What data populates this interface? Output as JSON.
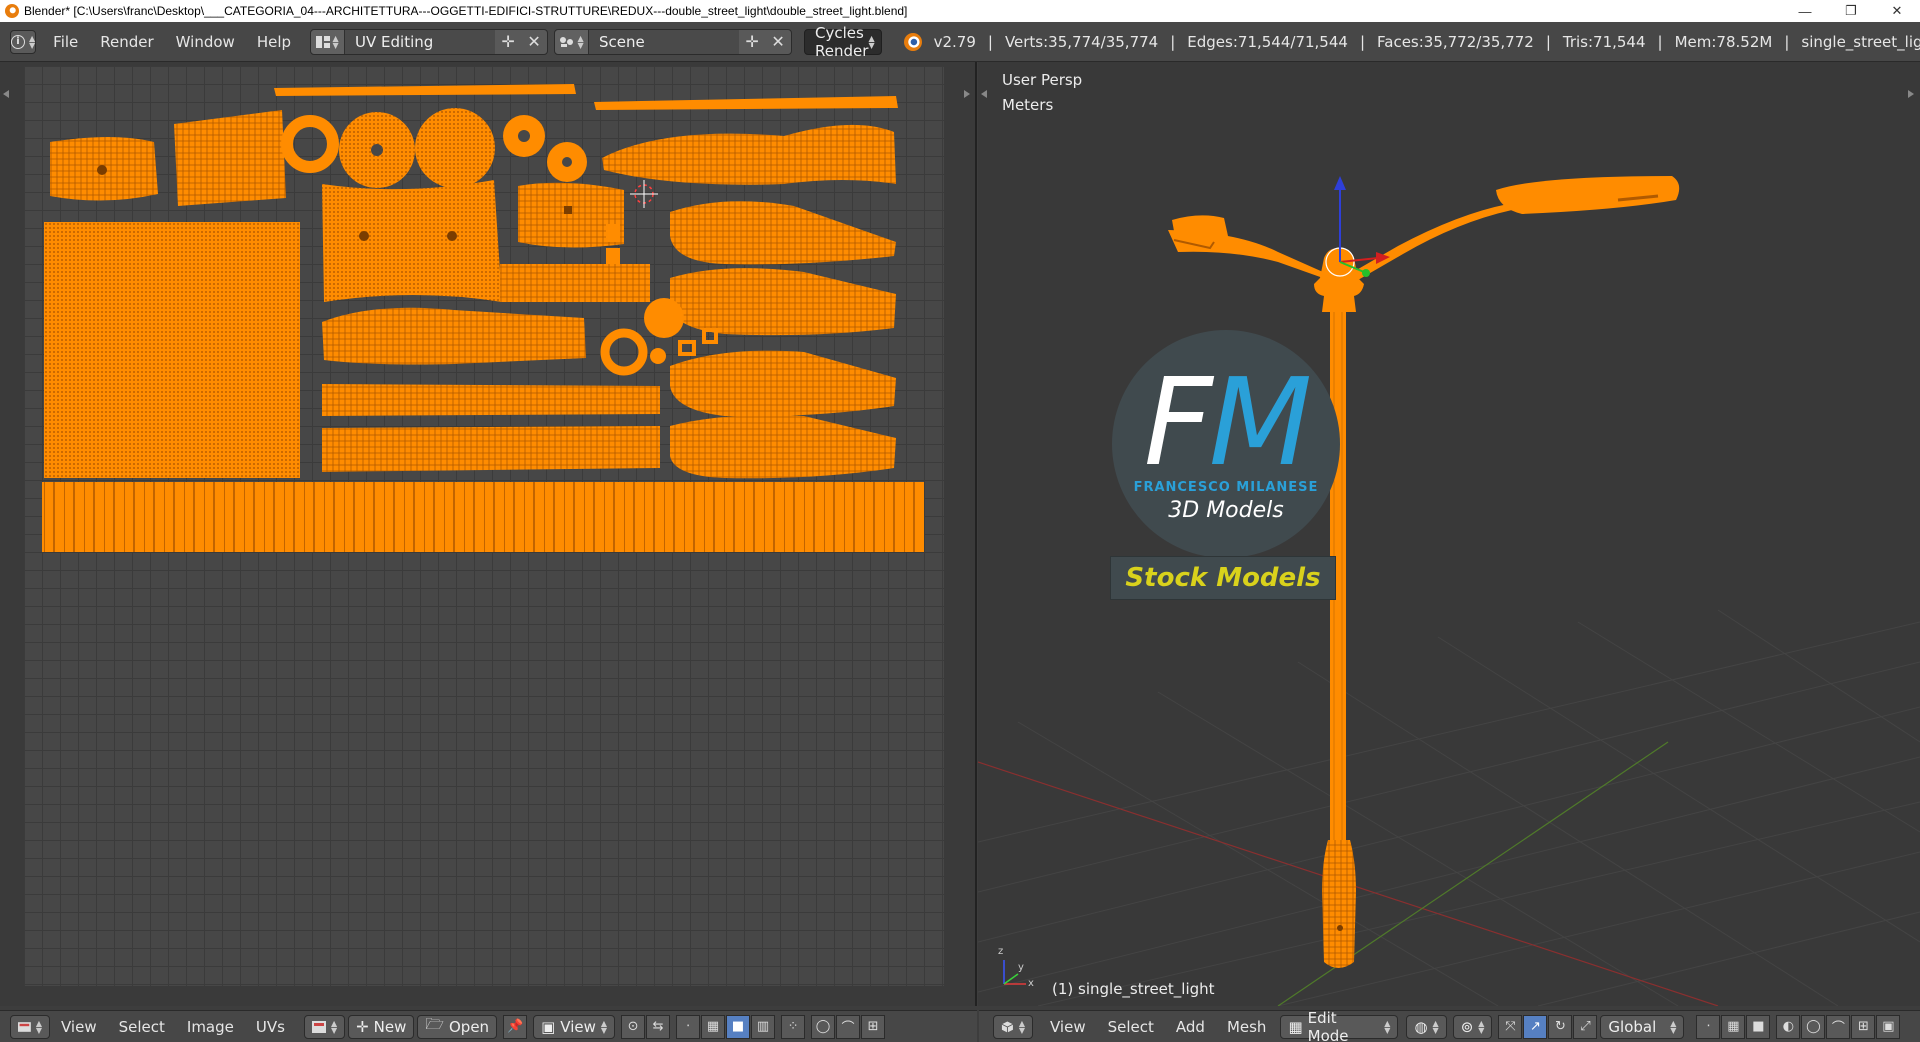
{
  "window": {
    "title": "Blender* [C:\\Users\\franc\\Desktop\\___CATEGORIA_04---ARCHITETTURA---OGGETTI-EDIFICI-STRUTTURE\\REDUX---double_street_light\\double_street_light.blend]",
    "minimize": "—",
    "restore": "❐",
    "close": "✕"
  },
  "info_header": {
    "menus": [
      "File",
      "Render",
      "Window",
      "Help"
    ],
    "screen_layout": "UV Editing",
    "scene": "Scene",
    "render_engine": "Cycles Render",
    "stats": {
      "version": "v2.79",
      "verts": "Verts:35,774/35,774",
      "edges": "Edges:71,544/71,544",
      "faces": "Faces:35,772/35,772",
      "tris": "Tris:71,544",
      "mem": "Mem:78.52M",
      "object": "single_street_light"
    }
  },
  "viewport": {
    "view_name": "User Persp",
    "units": "Meters",
    "object_label": "(1) single_street_light",
    "axis_x": "x",
    "axis_y": "y",
    "axis_z": "z"
  },
  "watermark": {
    "letter_f": "F",
    "letter_m": "M",
    "name": "FRANCESCO MILANESE",
    "tagline": "3D Models",
    "stock": "Stock Models"
  },
  "uv_footer": {
    "menus": [
      "View",
      "Select",
      "Image",
      "UVs"
    ],
    "new_label": "New",
    "open_label": "Open",
    "view_label": "View"
  },
  "viewport_footer": {
    "menus": [
      "View",
      "Select",
      "Add",
      "Mesh"
    ],
    "mode": "Edit Mode",
    "orientation": "Global"
  },
  "colors": {
    "mesh_orange": "#ff8c00",
    "brand_blue": "#2aa0d8",
    "stock_yellow": "#d9d21c"
  }
}
